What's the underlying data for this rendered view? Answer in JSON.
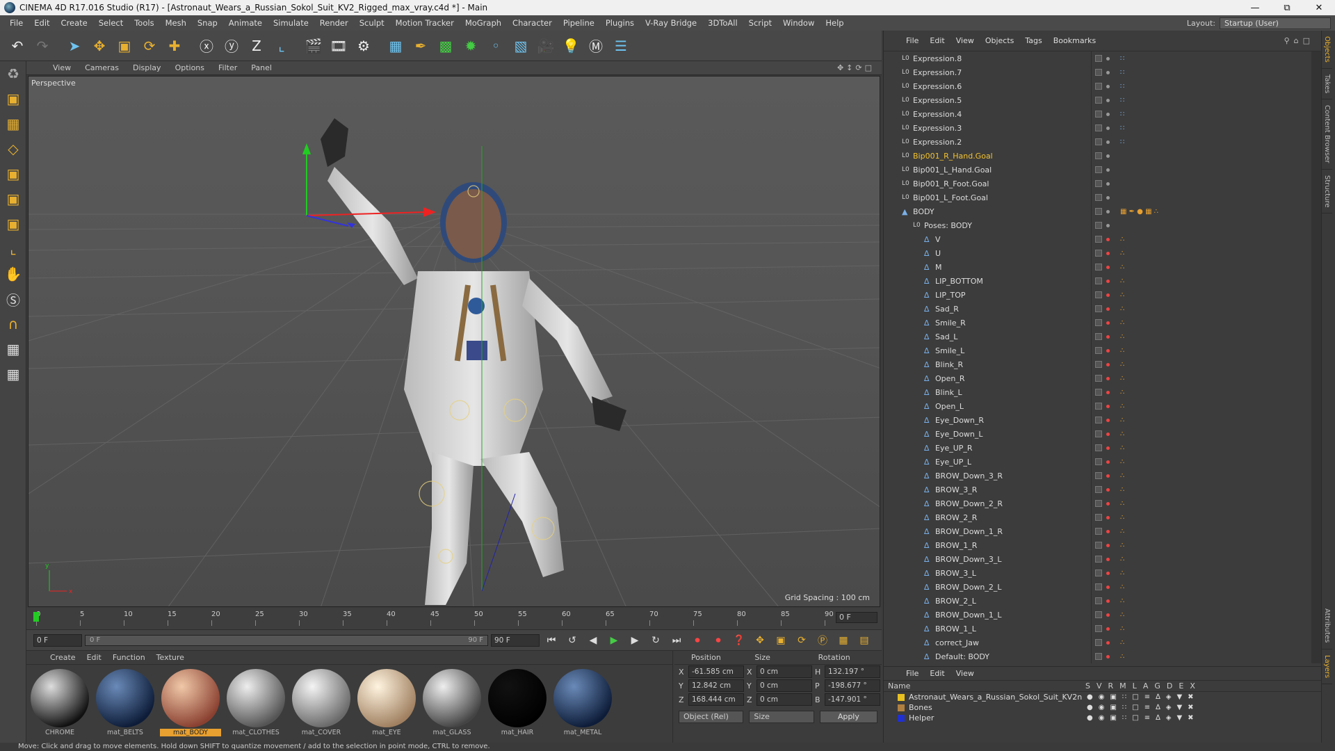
{
  "window": {
    "title": "CINEMA 4D R17.016 Studio (R17) - [Astronaut_Wears_a_Russian_Sokol_Suit_KV2_Rigged_max_vray.c4d *] - Main"
  },
  "menu": [
    "File",
    "Edit",
    "Create",
    "Select",
    "Tools",
    "Mesh",
    "Snap",
    "Animate",
    "Simulate",
    "Render",
    "Sculpt",
    "Motion Tracker",
    "MoGraph",
    "Character",
    "Pipeline",
    "Plugins",
    "V-Ray Bridge",
    "3DToAll",
    "Script",
    "Window",
    "Help"
  ],
  "layout": {
    "label": "Layout:",
    "value": "Startup (User)"
  },
  "viewport": {
    "menu": [
      "View",
      "Cameras",
      "Display",
      "Options",
      "Filter",
      "Panel"
    ],
    "label": "Perspective",
    "grid_spacing": "Grid Spacing : 100 cm"
  },
  "timeline": {
    "ticks": [
      "0",
      "5",
      "10",
      "15",
      "20",
      "25",
      "30",
      "35",
      "40",
      "45",
      "50",
      "55",
      "60",
      "65",
      "70",
      "75",
      "80",
      "85",
      "90"
    ],
    "current_frame": "0 F",
    "start_field": "0 F",
    "range_start": "0 F",
    "range_end": "90 F",
    "end_field": "90 F"
  },
  "materials": {
    "menu": [
      "Create",
      "Edit",
      "Function",
      "Texture"
    ],
    "items": [
      {
        "name": "CHROME",
        "c1": "#ddd",
        "c2": "#111"
      },
      {
        "name": "mat_BELTS",
        "c1": "#6a8ab8",
        "c2": "#0d1c38"
      },
      {
        "name": "mat_BODY",
        "c1": "#f0c8a8",
        "c2": "#8a4030",
        "selected": true
      },
      {
        "name": "mat_CLOTHES",
        "c1": "#eee",
        "c2": "#555"
      },
      {
        "name": "mat_COVER",
        "c1": "#f4f4f4",
        "c2": "#6a6a6a"
      },
      {
        "name": "mat_EYE",
        "c1": "#fff4e0",
        "c2": "#a08060"
      },
      {
        "name": "mat_GLASS",
        "c1": "#eee",
        "c2": "#444"
      },
      {
        "name": "mat_HAIR",
        "c1": "#111",
        "c2": "#000"
      },
      {
        "name": "mat_METAL",
        "c1": "#6a8ab8",
        "c2": "#0d1c38"
      }
    ]
  },
  "coords": {
    "headers": [
      "Position",
      "Size",
      "Rotation"
    ],
    "rows": [
      {
        "axis": "X",
        "pos": "-61.585 cm",
        "saxis": "X",
        "size": "0 cm",
        "raxis": "H",
        "rot": "132.197 °"
      },
      {
        "axis": "Y",
        "pos": "12.842 cm",
        "saxis": "Y",
        "size": "0 cm",
        "raxis": "P",
        "rot": "-198.677 °"
      },
      {
        "axis": "Z",
        "pos": "168.444 cm",
        "saxis": "Z",
        "size": "0 cm",
        "raxis": "B",
        "rot": "-147.901 °"
      }
    ],
    "mode": "Object (Rel)",
    "size_mode": "Size",
    "apply": "Apply"
  },
  "objects": {
    "menu": [
      "File",
      "Edit",
      "View",
      "Objects",
      "Tags",
      "Bookmarks"
    ],
    "rows": [
      {
        "name": "Expression.8",
        "indent": 0,
        "type": "null"
      },
      {
        "name": "Expression.7",
        "indent": 0,
        "type": "null"
      },
      {
        "name": "Expression.6",
        "indent": 0,
        "type": "null"
      },
      {
        "name": "Expression.5",
        "indent": 0,
        "type": "null"
      },
      {
        "name": "Expression.4",
        "indent": 0,
        "type": "null"
      },
      {
        "name": "Expression.3",
        "indent": 0,
        "type": "null"
      },
      {
        "name": "Expression.2",
        "indent": 0,
        "type": "null"
      },
      {
        "name": "Bip001_R_Hand.Goal",
        "indent": 0,
        "type": "null",
        "hl": true
      },
      {
        "name": "Bip001_L_Hand.Goal",
        "indent": 0,
        "type": "null"
      },
      {
        "name": "Bip001_R_Foot.Goal",
        "indent": 0,
        "type": "null"
      },
      {
        "name": "Bip001_L_Foot.Goal",
        "indent": 0,
        "type": "null"
      },
      {
        "name": "BODY",
        "indent": 0,
        "type": "mesh"
      },
      {
        "name": "Poses: BODY",
        "indent": 1,
        "type": "null"
      },
      {
        "name": "V",
        "indent": 2,
        "type": "pose"
      },
      {
        "name": "U",
        "indent": 2,
        "type": "pose"
      },
      {
        "name": "M",
        "indent": 2,
        "type": "pose"
      },
      {
        "name": "LIP_BOTTOM",
        "indent": 2,
        "type": "pose"
      },
      {
        "name": "LIP_TOP",
        "indent": 2,
        "type": "pose"
      },
      {
        "name": "Sad_R",
        "indent": 2,
        "type": "pose"
      },
      {
        "name": "Smile_R",
        "indent": 2,
        "type": "pose"
      },
      {
        "name": "Sad_L",
        "indent": 2,
        "type": "pose"
      },
      {
        "name": "Smile_L",
        "indent": 2,
        "type": "pose"
      },
      {
        "name": "Blink_R",
        "indent": 2,
        "type": "pose"
      },
      {
        "name": "Open_R",
        "indent": 2,
        "type": "pose"
      },
      {
        "name": "Blink_L",
        "indent": 2,
        "type": "pose"
      },
      {
        "name": "Open_L",
        "indent": 2,
        "type": "pose"
      },
      {
        "name": "Eye_Down_R",
        "indent": 2,
        "type": "pose"
      },
      {
        "name": "Eye_Down_L",
        "indent": 2,
        "type": "pose"
      },
      {
        "name": "Eye_UP_R",
        "indent": 2,
        "type": "pose"
      },
      {
        "name": "Eye_UP_L",
        "indent": 2,
        "type": "pose"
      },
      {
        "name": "BROW_Down_3_R",
        "indent": 2,
        "type": "pose"
      },
      {
        "name": "BROW_3_R",
        "indent": 2,
        "type": "pose"
      },
      {
        "name": "BROW_Down_2_R",
        "indent": 2,
        "type": "pose"
      },
      {
        "name": "BROW_2_R",
        "indent": 2,
        "type": "pose"
      },
      {
        "name": "BROW_Down_1_R",
        "indent": 2,
        "type": "pose"
      },
      {
        "name": "BROW_1_R",
        "indent": 2,
        "type": "pose"
      },
      {
        "name": "BROW_Down_3_L",
        "indent": 2,
        "type": "pose"
      },
      {
        "name": "BROW_3_L",
        "indent": 2,
        "type": "pose"
      },
      {
        "name": "BROW_Down_2_L",
        "indent": 2,
        "type": "pose"
      },
      {
        "name": "BROW_2_L",
        "indent": 2,
        "type": "pose"
      },
      {
        "name": "BROW_Down_1_L",
        "indent": 2,
        "type": "pose"
      },
      {
        "name": "BROW_1_L",
        "indent": 2,
        "type": "pose"
      },
      {
        "name": "correct_Jaw",
        "indent": 2,
        "type": "pose"
      },
      {
        "name": "Default: BODY",
        "indent": 2,
        "type": "pose"
      }
    ]
  },
  "layers": {
    "menu": [
      "File",
      "Edit",
      "View"
    ],
    "name_header": "Name",
    "col_headers": [
      "S",
      "V",
      "R",
      "M",
      "L",
      "A",
      "G",
      "D",
      "E",
      "X"
    ],
    "rows": [
      {
        "name": "Astronaut_Wears_a_Russian_Sokol_Suit_KV2n",
        "color": "#e8c020"
      },
      {
        "name": "Bones",
        "color": "#b08040"
      },
      {
        "name": "Helper",
        "color": "#2030d0"
      }
    ]
  },
  "side_tabs": [
    "Objects",
    "Takes",
    "Content Browser",
    "Structure"
  ],
  "side_tabs_lower": [
    "Attributes",
    "Layers"
  ],
  "status": "Move: Click and drag to move elements. Hold down SHIFT to quantize movement / add to the selection in point mode, CTRL to remove."
}
